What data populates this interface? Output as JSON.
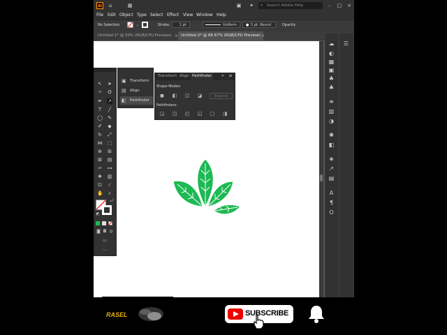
{
  "app": {
    "logo": "Ai",
    "search_placeholder": "Search Adobe Help"
  },
  "menu": [
    "File",
    "Edit",
    "Object",
    "Type",
    "Select",
    "Effect",
    "View",
    "Window",
    "Help"
  ],
  "control_bar": {
    "selection": "No Selection",
    "stroke_label": "Stroke:",
    "stroke_value": "1 pt",
    "profile": "Uniform",
    "brush": "5 pt. Round",
    "opacity_label": "Opacity"
  },
  "doc_tabs": [
    {
      "label": "Untitled-1* @ 50% (RGB/CPU Preview)",
      "active": false
    },
    {
      "label": "Untitled-2* @ 66.67% (RGB/CPU Preview)",
      "active": true
    }
  ],
  "lib_panel": {
    "items": [
      "Transform",
      "Align",
      "Pathfinder"
    ],
    "active_index": 2
  },
  "pathfinder": {
    "tabs": [
      "Transform",
      "Align",
      "Pathfinder"
    ],
    "active_tab": 2,
    "shape_modes_label": "Shape Modes:",
    "pathfinders_label": "Pathfinders:",
    "expand_label": "Expand"
  },
  "artwork": {
    "leaf_color": "#1db954"
  },
  "overlay": {
    "subscribe_label": "SUBSCRIBE",
    "channel_logo_text": "RASEL",
    "youtube_red": "#e00000"
  }
}
